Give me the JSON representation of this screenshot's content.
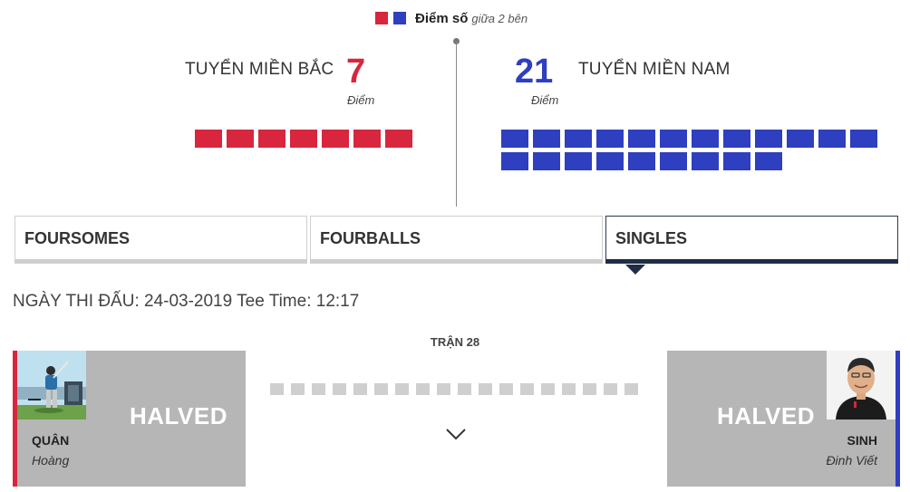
{
  "legend": {
    "title": "Điểm số",
    "subtitle": "giữa 2 bên",
    "colors": {
      "north": "#d7263d",
      "south": "#2e3fbf"
    }
  },
  "teams": {
    "north": {
      "name": "TUYỂN MIỀN BẮC",
      "score": "7",
      "points_label": "Điểm",
      "color": "#d7263d",
      "points": 7
    },
    "south": {
      "name": "TUYỂN MIỀN NAM",
      "score": "21",
      "points_label": "Điểm",
      "color": "#2e3fbf",
      "points": 21
    }
  },
  "tabs": [
    {
      "label": "FOURSOMES",
      "active": false
    },
    {
      "label": "FOURBALLS",
      "active": false
    },
    {
      "label": "SINGLES",
      "active": true
    }
  ],
  "schedule": {
    "text": "NGÀY THI ĐẤU: 24-03-2019 Tee Time: 12:17"
  },
  "match": {
    "title": "TRẬN 28",
    "left_player": {
      "last": "QUÂN",
      "first": "Hoàng",
      "result": "HALVED"
    },
    "right_player": {
      "last": "SINH",
      "first": "Đinh Viết",
      "result": "HALVED"
    },
    "holes_progress": 18,
    "expand_icon": "chevron-down-icon"
  }
}
